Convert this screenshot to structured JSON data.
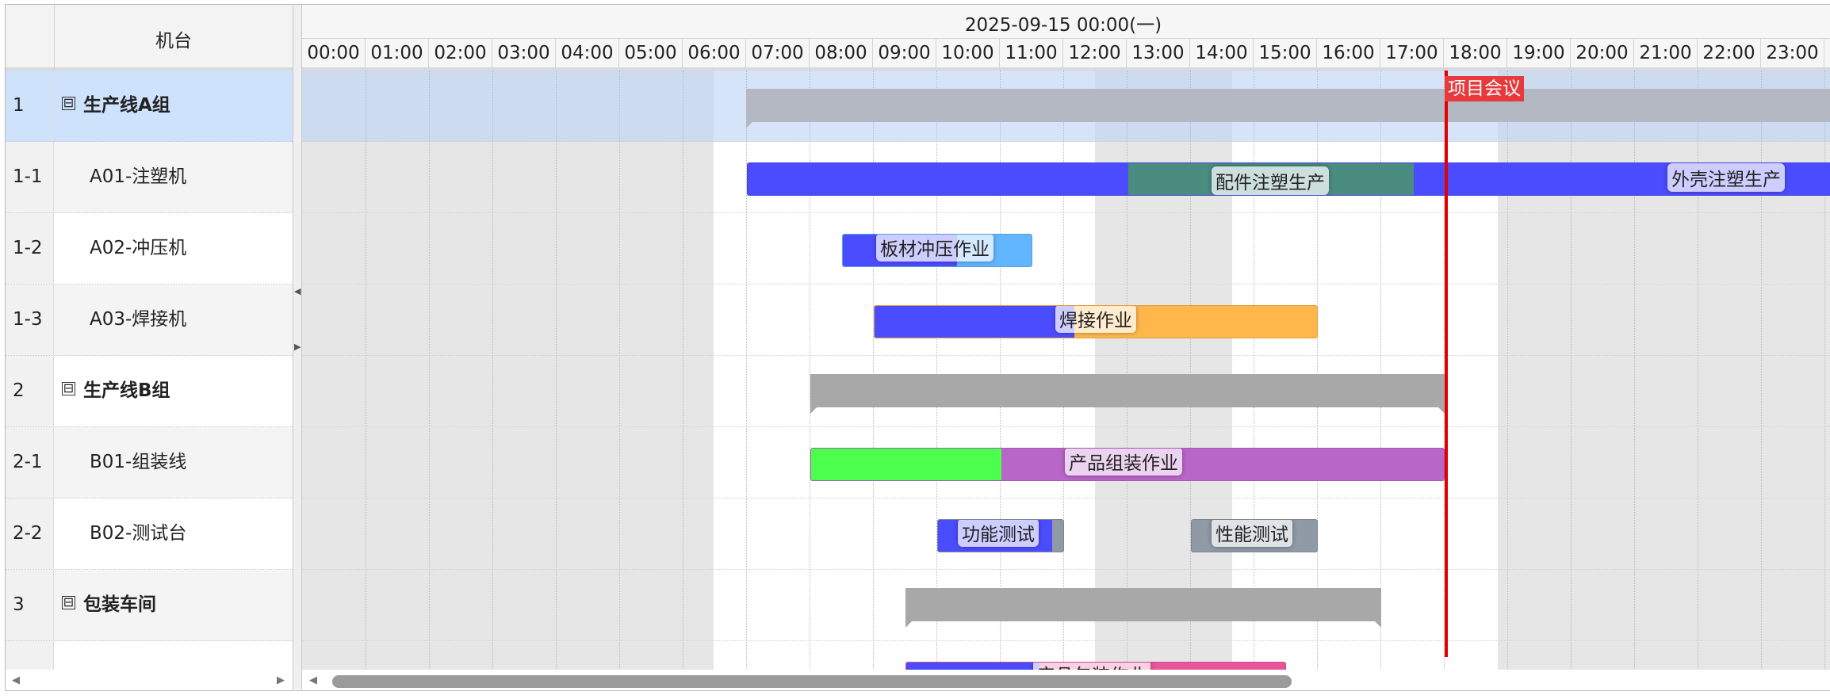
{
  "left": {
    "header_title": "机台",
    "rows": [
      {
        "num": "1",
        "name": "生产线A组",
        "group": true,
        "toggle": "⊟"
      },
      {
        "num": "1-1",
        "name": "A01-注塑机",
        "group": false
      },
      {
        "num": "1-2",
        "name": "A02-冲压机",
        "group": false
      },
      {
        "num": "1-3",
        "name": "A03-焊接机",
        "group": false
      },
      {
        "num": "2",
        "name": "生产线B组",
        "group": true,
        "toggle": "⊟"
      },
      {
        "num": "2-1",
        "name": "B01-组装线",
        "group": false
      },
      {
        "num": "2-2",
        "name": "B02-测试台",
        "group": false
      },
      {
        "num": "3",
        "name": "包装车间",
        "group": true,
        "toggle": "⊟"
      }
    ]
  },
  "timeline": {
    "date_header": "2025-09-15 00:00(一)",
    "hours": [
      "00:00",
      "01:00",
      "02:00",
      "03:00",
      "04:00",
      "05:00",
      "06:00",
      "07:00",
      "08:00",
      "09:00",
      "10:00",
      "11:00",
      "12:00",
      "13:00",
      "14:00",
      "15:00",
      "16:00",
      "17:00",
      "18:00",
      "19:00",
      "20:00",
      "21:00",
      "22:00",
      "23:00"
    ]
  },
  "tasks": {
    "injection_a": {
      "label": "配件注塑生产"
    },
    "injection_b": {
      "label": "外壳注塑生产"
    },
    "stamping": {
      "label": "板材冲压作业",
      "progress": 0.6
    },
    "welding": {
      "label": "焊接作业",
      "progress": 0.45
    },
    "assembly": {
      "label": "产品组装作业",
      "progress": 0.3
    },
    "func_test": {
      "label": "功能测试",
      "progress": 0.9
    },
    "perf_test": {
      "label": "性能测试"
    },
    "packaging": {
      "label": "产品包装作业",
      "progress": 0.35
    }
  },
  "marker": {
    "label": "项目会议",
    "time": "18:00"
  },
  "colors": {
    "progress": "#4c4cff",
    "injection": "#4a8c80",
    "stamping": "#62b5ff",
    "welding": "#ffb74c",
    "assembly": "#b966c9",
    "assembly_progress": "#4cff4c",
    "func_test": "#8f9aa6",
    "perf_test": "#8f9aa6",
    "packaging": "#e8569a",
    "marker": "#e30000",
    "selected_row": "#cfe2fc"
  }
}
